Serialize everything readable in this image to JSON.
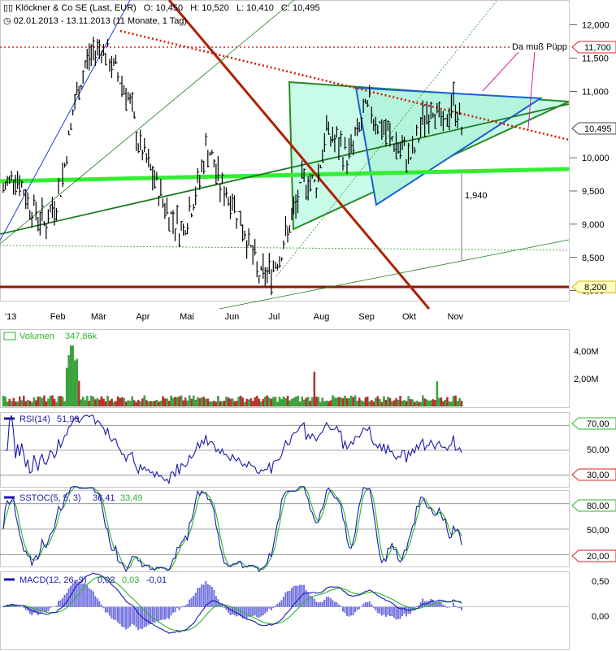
{
  "header": {
    "title": "Klöckner & Co SE (Last, EUR)",
    "open": "O: 10,450",
    "high": "H: 10,520",
    "low": "L: 10,410",
    "close": "C: 10,495",
    "range": "02.01.2013 - 13.11.2013 (11 Monate, 1 Tag)"
  },
  "colors": {
    "up": "#2bb52b",
    "down": "#d42020",
    "price_bar": "#000000",
    "rsi_line": "#1a1aa8",
    "stoch_k": "#1a1aa8",
    "stoch_d": "#2bb52b",
    "macd_line": "#1a1aa8",
    "signal_line": "#2bb52b",
    "histogram": "#7070e0",
    "triangle_fill": "#c8fbe8",
    "support_red": "#aa1a00",
    "neon_green": "#33ee33"
  },
  "chart_data": [
    {
      "type": "line",
      "title": "Klöckner & Co SE (Last, EUR)",
      "x_tick_labels": [
        "'13",
        "Feb",
        "Mär",
        "Apr",
        "Mai",
        "Jun",
        "Jul",
        "Aug",
        "Sep",
        "Okt",
        "Nov"
      ],
      "y_tick_labels": [
        "12,000",
        "11,500",
        "11,000",
        "10,000",
        "9,500",
        "9,000",
        "8,500",
        "8,000"
      ],
      "ylim": [
        7.8,
        12.3
      ],
      "grid": false,
      "price_points": [
        [
          "2013-01-02",
          9.5
        ],
        [
          "2013-01-10",
          9.8
        ],
        [
          "2013-01-20",
          9.3
        ],
        [
          "2013-01-31",
          9.0
        ],
        [
          "2013-02-10",
          9.5
        ],
        [
          "2013-02-20",
          10.8
        ],
        [
          "2013-03-01",
          11.5
        ],
        [
          "2013-03-10",
          11.7
        ],
        [
          "2013-03-20",
          11.3
        ],
        [
          "2013-03-28",
          11.0
        ],
        [
          "2013-04-05",
          10.2
        ],
        [
          "2013-04-15",
          9.7
        ],
        [
          "2013-04-25",
          9.2
        ],
        [
          "2013-05-05",
          8.9
        ],
        [
          "2013-05-15",
          9.5
        ],
        [
          "2013-05-22",
          10.2
        ],
        [
          "2013-05-31",
          9.6
        ],
        [
          "2013-06-10",
          9.3
        ],
        [
          "2013-06-20",
          8.7
        ],
        [
          "2013-06-27",
          8.2
        ],
        [
          "2013-07-05",
          8.3
        ],
        [
          "2013-07-12",
          8.6
        ],
        [
          "2013-07-20",
          9.1
        ],
        [
          "2013-07-28",
          9.7
        ],
        [
          "2013-08-05",
          9.6
        ],
        [
          "2013-08-12",
          10.4
        ],
        [
          "2013-08-20",
          10.2
        ],
        [
          "2013-08-27",
          10.0
        ],
        [
          "2013-09-03",
          10.4
        ],
        [
          "2013-09-10",
          10.8
        ],
        [
          "2013-09-17",
          10.5
        ],
        [
          "2013-09-25",
          10.3
        ],
        [
          "2013-10-02",
          10.1
        ],
        [
          "2013-10-10",
          10.0
        ],
        [
          "2013-10-18",
          10.6
        ],
        [
          "2013-10-25",
          10.8
        ],
        [
          "2013-11-01",
          10.4
        ],
        [
          "2013-11-07",
          10.9
        ],
        [
          "2013-11-13",
          10.495
        ]
      ],
      "value_labels": [
        {
          "text": "11,700",
          "value": 11.7,
          "style": "red-dotted"
        },
        {
          "text": "10,495",
          "value": 10.495,
          "style": "current"
        },
        {
          "text": "8,200",
          "value": 8.2,
          "style": "yellow"
        }
      ],
      "annotations": [
        {
          "text": "Da muß Püpp"
        },
        {
          "text": "1,940"
        }
      ]
    },
    {
      "type": "bar",
      "title": "Volumen",
      "last_value": "347,86k",
      "y_tick_labels": [
        "4,00M",
        "2,00M"
      ],
      "ylim": [
        0,
        4600000
      ]
    },
    {
      "type": "line",
      "title": "RSI(14)",
      "last_value": "51,99",
      "levels": [
        {
          "text": "70,00",
          "value": 70
        },
        {
          "text": "50,00",
          "value": 50
        },
        {
          "text": "30,00",
          "value": 30
        }
      ],
      "ylim": [
        20,
        80
      ]
    },
    {
      "type": "line",
      "title": "SSTOC(5, 5, 3)",
      "last_k": "36,41",
      "last_d": "33,49",
      "levels": [
        {
          "text": "80,00",
          "value": 80
        },
        {
          "text": "50,00",
          "value": 50
        },
        {
          "text": "20,00",
          "value": 20
        }
      ],
      "ylim": [
        5,
        95
      ]
    },
    {
      "type": "line",
      "title": "MACD(12, 26, 9)",
      "macd": "0,02",
      "signal": "0,03",
      "hist": "-0,01",
      "y_tick_labels": [
        "0,50",
        "0,00"
      ],
      "ylim": [
        -0.75,
        0.6
      ]
    }
  ]
}
